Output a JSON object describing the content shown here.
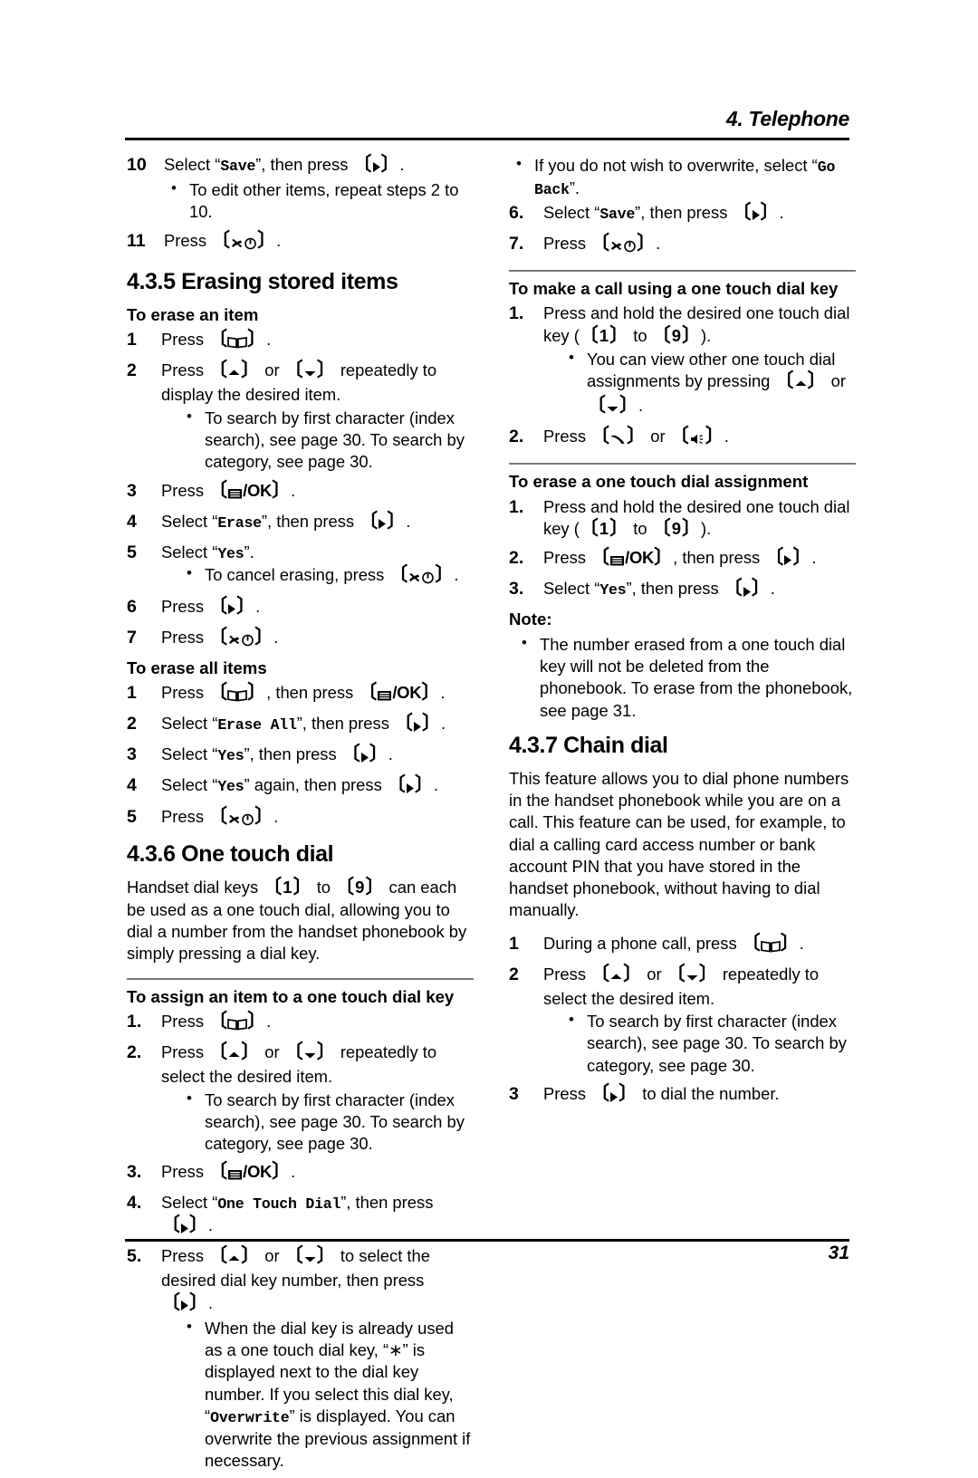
{
  "header": {
    "title": "4. Telephone"
  },
  "footer": {
    "page_number": "31"
  },
  "icons": {
    "phonebook": "phonebook-book-icon",
    "menu_ok": "menu-ok-icon",
    "up": "up-arrow-icon",
    "down": "down-arrow-icon",
    "right": "right-arrow-icon",
    "off_power": "off-power-icon",
    "talk": "talk-handset-icon",
    "speaker": "speakerphone-icon"
  },
  "left_column": {
    "step10": {
      "num": "10",
      "text_a": "Select “",
      "disp": "Save",
      "text_b": "”, then press ",
      "text_c": ".",
      "bullet": "To edit other items, repeat steps 2 to 10."
    },
    "step11": {
      "num": "11",
      "text_a": "Press ",
      "text_b": "."
    },
    "section_435": {
      "heading": "4.3.5 Erasing stored items"
    },
    "erase_item": {
      "subheading": "To erase an item",
      "steps": [
        {
          "num": "1",
          "text_a": "Press ",
          "text_b": "."
        },
        {
          "num": "2",
          "text_a": "Press ",
          "text_mid": " or ",
          "text_b": " repeatedly to display the desired item.",
          "bullet": "To search by first character (index search), see page 30. To search by category, see page 30."
        },
        {
          "num": "3",
          "text_a": "Press ",
          "text_b": "."
        },
        {
          "num": "4",
          "text_a": "Select “",
          "disp": "Erase",
          "text_b": "”, then press ",
          "text_c": "."
        },
        {
          "num": "5",
          "text_a": "Select “",
          "disp": "Yes",
          "text_b": "”.",
          "bullet_a": "To cancel erasing, press ",
          "bullet_b": "."
        },
        {
          "num": "6",
          "text_a": "Press ",
          "text_b": "."
        },
        {
          "num": "7",
          "text_a": "Press ",
          "text_b": "."
        }
      ]
    },
    "erase_all": {
      "subheading": "To erase all items",
      "steps": [
        {
          "num": "1",
          "text_a": "Press ",
          "text_mid": ", then press ",
          "text_b": "."
        },
        {
          "num": "2",
          "text_a": "Select “",
          "disp": "Erase All",
          "text_b": "”, then press ",
          "text_c": "."
        },
        {
          "num": "3",
          "text_a": "Select “",
          "disp": "Yes",
          "text_b": "”, then press ",
          "text_c": "."
        },
        {
          "num": "4",
          "text_a": "Select “",
          "disp": "Yes",
          "text_b": "” again, then press ",
          "text_c": "."
        },
        {
          "num": "5",
          "text_a": "Press ",
          "text_b": "."
        }
      ]
    },
    "section_436": {
      "heading": "4.3.6 One touch dial",
      "intro_a": "Handset dial keys ",
      "key_low": "1",
      "intro_mid": " to ",
      "key_high": "9",
      "intro_b": " can each be used as a one touch dial, allowing you to dial a number from the handset phonebook by simply pressing a dial key."
    },
    "assign": {
      "subheading": "To assign an item to a one touch dial key",
      "steps": [
        {
          "num": "1.",
          "text_a": "Press ",
          "text_b": "."
        },
        {
          "num": "2.",
          "text_a": "Press ",
          "text_mid": " or ",
          "text_b": " repeatedly to select the desired item.",
          "bullet": "To search by first character (index search), see page 30. To search by category, see page 30."
        },
        {
          "num": "3.",
          "text_a": "Press ",
          "text_b": "."
        },
        {
          "num": "4.",
          "text_a": "Select “",
          "disp": "One Touch Dial",
          "text_b": "”, then press ",
          "text_c": "."
        },
        {
          "num": "5.",
          "text_a": "Press ",
          "text_mid": " or ",
          "text_b": " to select the desired dial key number, then press ",
          "text_c": ".",
          "bullet_a": "When the dial key is already used as a one touch dial key, “",
          "bullet_star": "∗",
          "bullet_b": "” is displayed next to the dial key number. If you select this dial key, “",
          "bullet_disp": "Overwrite",
          "bullet_c": "” is displayed. You can overwrite the previous assignment if necessary."
        }
      ]
    }
  },
  "right_column": {
    "overwrite_bullet": {
      "text_a": "If you do not wish to overwrite, select “",
      "disp": "Go Back",
      "text_b": "”."
    },
    "step6": {
      "num": "6.",
      "text_a": "Select “",
      "disp": "Save",
      "text_b": "”, then press ",
      "text_c": "."
    },
    "step7": {
      "num": "7.",
      "text_a": "Press ",
      "text_b": "."
    },
    "make_call": {
      "subheading": "To make a call using a one touch dial key",
      "steps": [
        {
          "num": "1.",
          "text_a": "Press and hold the desired one touch dial key (",
          "key_low": "1",
          "text_mid": " to ",
          "key_high": "9",
          "text_b": ").",
          "bullet_a": "You can view other one touch dial assignments by pressing ",
          "bullet_mid": " or ",
          "bullet_b": "."
        },
        {
          "num": "2.",
          "text_a": "Press ",
          "text_mid": " or ",
          "text_b": "."
        }
      ]
    },
    "erase_assignment": {
      "subheading": "To erase a one touch dial assignment",
      "steps": [
        {
          "num": "1.",
          "text_a": "Press and hold the desired one touch dial key (",
          "key_low": "1",
          "text_mid": " to ",
          "key_high": "9",
          "text_b": ")."
        },
        {
          "num": "2.",
          "text_a": "Press ",
          "text_mid": ", then press ",
          "text_b": "."
        },
        {
          "num": "3.",
          "text_a": "Select “",
          "disp": "Yes",
          "text_b": "”, then press ",
          "text_c": "."
        }
      ],
      "note_label": "Note:",
      "note_bullet": "The number erased from a one touch dial key will not be deleted from the phonebook. To erase from the phonebook, see page 31."
    },
    "section_437": {
      "heading": "4.3.7 Chain dial",
      "intro": "This feature allows you to dial phone numbers in the handset phonebook while you are on a call. This feature can be used, for example, to dial a calling card access number or bank account PIN that you have stored in the handset phonebook, without having to dial manually.",
      "steps": [
        {
          "num": "1",
          "text_a": "During a phone call, press ",
          "text_b": "."
        },
        {
          "num": "2",
          "text_a": "Press ",
          "text_mid": " or ",
          "text_b": " repeatedly to select the desired item.",
          "bullet": "To search by first character (index search), see page 30. To search by category, see page 30."
        },
        {
          "num": "3",
          "text_a": "Press ",
          "text_b": " to dial the number."
        }
      ]
    }
  }
}
